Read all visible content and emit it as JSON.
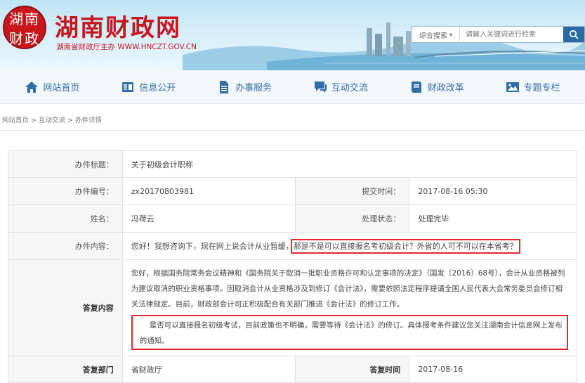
{
  "header": {
    "logo_text": "湖南财政",
    "site_title": "湖南财政网",
    "subtitle": "湖南省财政厅主办 WWW.HNCZT.GOV.CN",
    "search": {
      "scope_label": "综合搜索",
      "placeholder": "请输入关键词进行检索"
    }
  },
  "nav": {
    "items": [
      {
        "label": "网站首页",
        "icon": "home-icon"
      },
      {
        "label": "信息公开",
        "icon": "document-icon"
      },
      {
        "label": "办事服务",
        "icon": "file-icon"
      },
      {
        "label": "互动交流",
        "icon": "chat-icon"
      },
      {
        "label": "财政改革",
        "icon": "book-icon"
      },
      {
        "label": "专题专栏",
        "icon": "image-icon"
      }
    ]
  },
  "breadcrumb": {
    "home": "网站首页",
    "section": "互动交流",
    "current": "办件详情",
    "sep": " > "
  },
  "detail": {
    "title_label": "办件标题：",
    "title_value": "关于初级会计职称",
    "number_label": "办件编号：",
    "number_value": "zx20170803981",
    "submit_label": "提交时间：",
    "submit_value": "2017-08-16 05:30",
    "name_label": "姓名：",
    "name_value": "冯荷云",
    "status_label": "处理状态：",
    "status_value": "处理完毕",
    "content_label": "办件内容：",
    "content_prefix": "您好！我想咨询下，现在网上说会计从业暂缓，",
    "content_highlight": "那是不是可以直接报名考初级会计？外省的人可不可以在本省考？",
    "reply_label": "答复内容",
    "reply_para1": "您好，根据国务院常务会议精神和《国务院关于取消一批职业资格许可和认定事项的决定》（国发〔2016〕68号），会计从业资格被列为建议取消的职业资格事项。因取消会计从业资格涉及到修订《会计法》，需要依照法定程序提请全国人民代表大会常务委员会修订相关法律规定。目前，财政部会计司正积极配合有关部门推进《会计法》的修订工作。",
    "reply_para2": "是否可以直接报名初级考试，目前政策也不明确，需要等待《会计法》的修订。具体报考条件建议您关注湖南会计信息网上发布的通知。",
    "dept_label": "答复部门",
    "dept_value": "省财政厅",
    "reply_time_label": "答复时间",
    "reply_time_value": "2017-08-16"
  },
  "colors": {
    "brand_red": "#c8161d",
    "nav_blue": "#2e6ea7",
    "highlight_border": "#e0272e"
  }
}
